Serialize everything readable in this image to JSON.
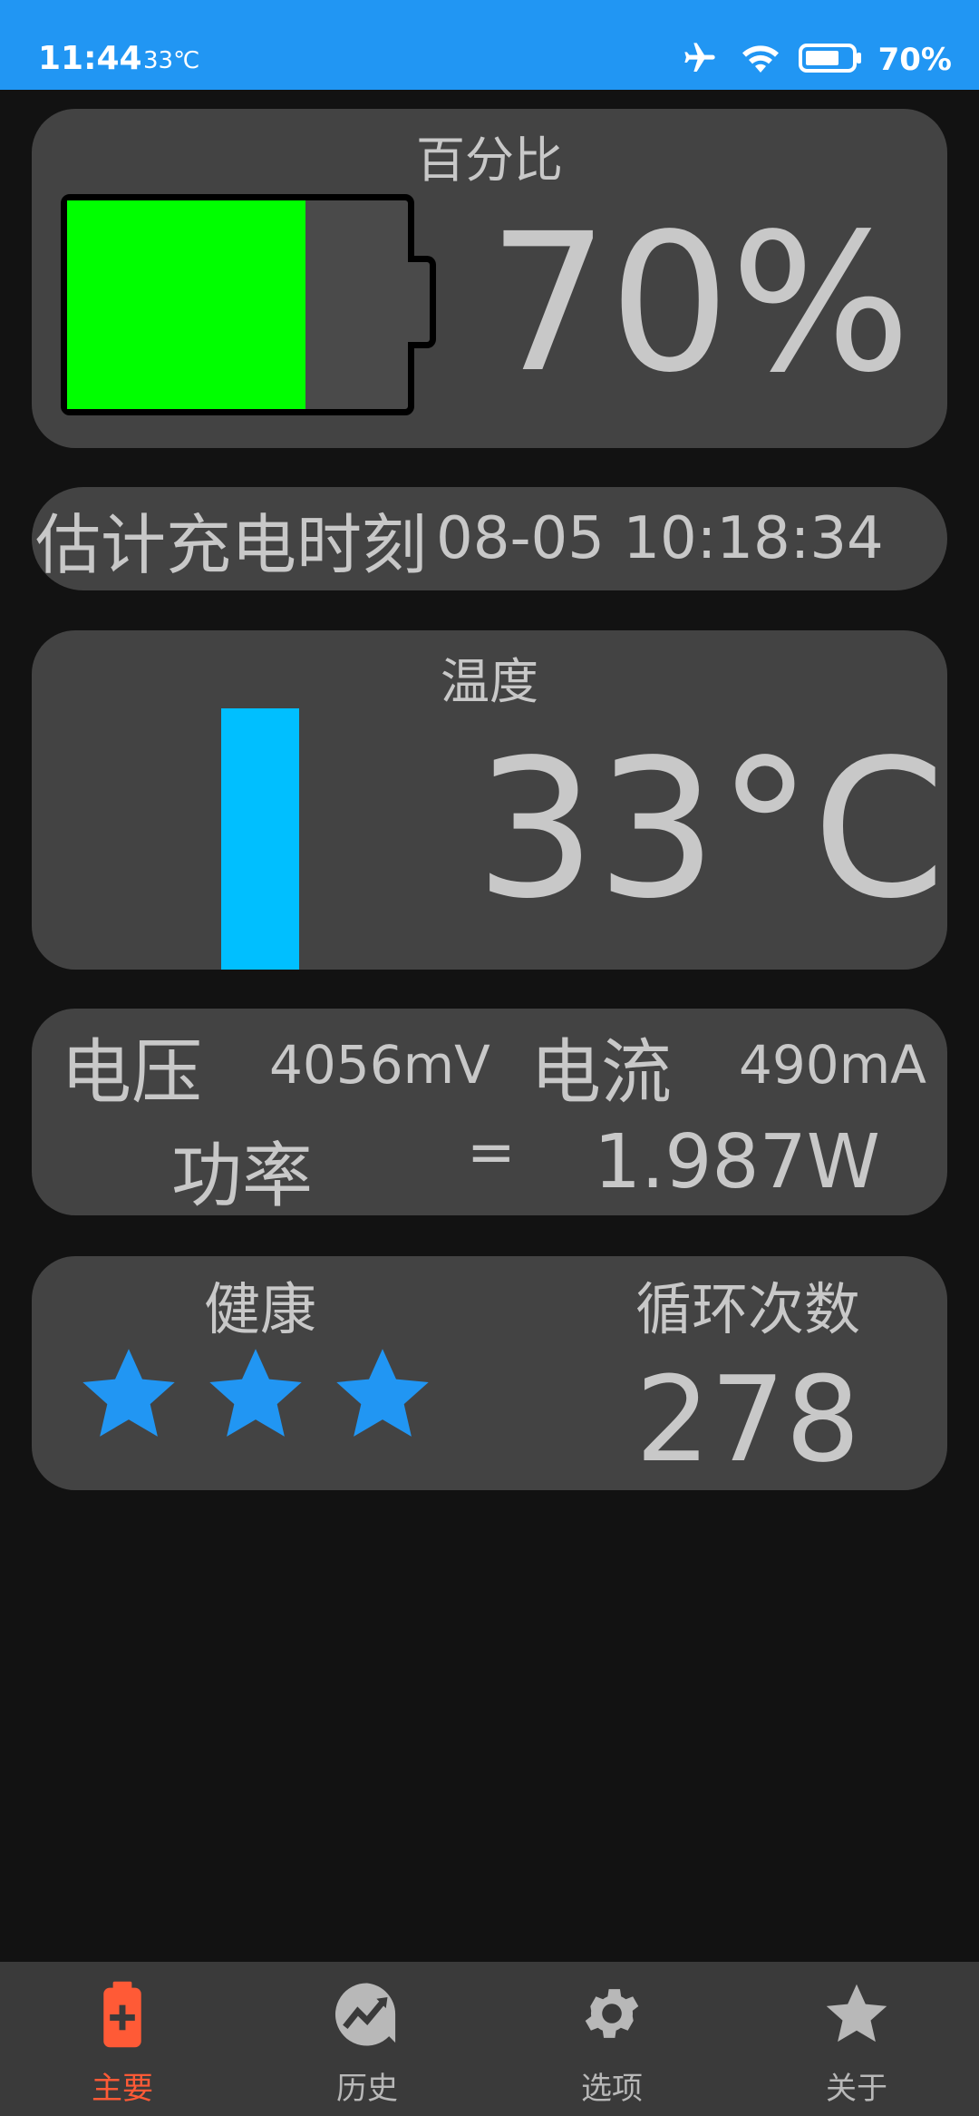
{
  "status_bar": {
    "time": "11:44",
    "temperature": "33℃",
    "battery_percent": "70%",
    "icons": [
      "airplane-icon",
      "wifi-icon",
      "battery-icon"
    ]
  },
  "percentage_card": {
    "title": "百分比",
    "value": "70%",
    "battery_level": 0.7,
    "fill_color": "#00ff00"
  },
  "charge_time_card": {
    "label": "估计充电时刻",
    "value": "08-05 10:18:34"
  },
  "temperature_card": {
    "title": "温度",
    "value": "33°C",
    "bar_color": "#00bfff"
  },
  "power_card": {
    "voltage_label": "电压",
    "voltage_value": "4056mV",
    "current_label": "电流",
    "current_value": "490mA",
    "power_label": "功率",
    "equals": "=",
    "power_value": "1.987W"
  },
  "health_card": {
    "health_label": "健康",
    "health_stars": 3,
    "star_color": "#2196f3",
    "cycles_label": "循环次数",
    "cycles_value": "278"
  },
  "bottom_nav": {
    "items": [
      {
        "label": "主要",
        "icon": "battery-plus-icon",
        "active": true
      },
      {
        "label": "历史",
        "icon": "history-chart-icon",
        "active": false
      },
      {
        "label": "选项",
        "icon": "gear-icon",
        "active": false
      },
      {
        "label": "关于",
        "icon": "star-icon",
        "active": false
      }
    ],
    "active_color": "#ff5a36"
  }
}
